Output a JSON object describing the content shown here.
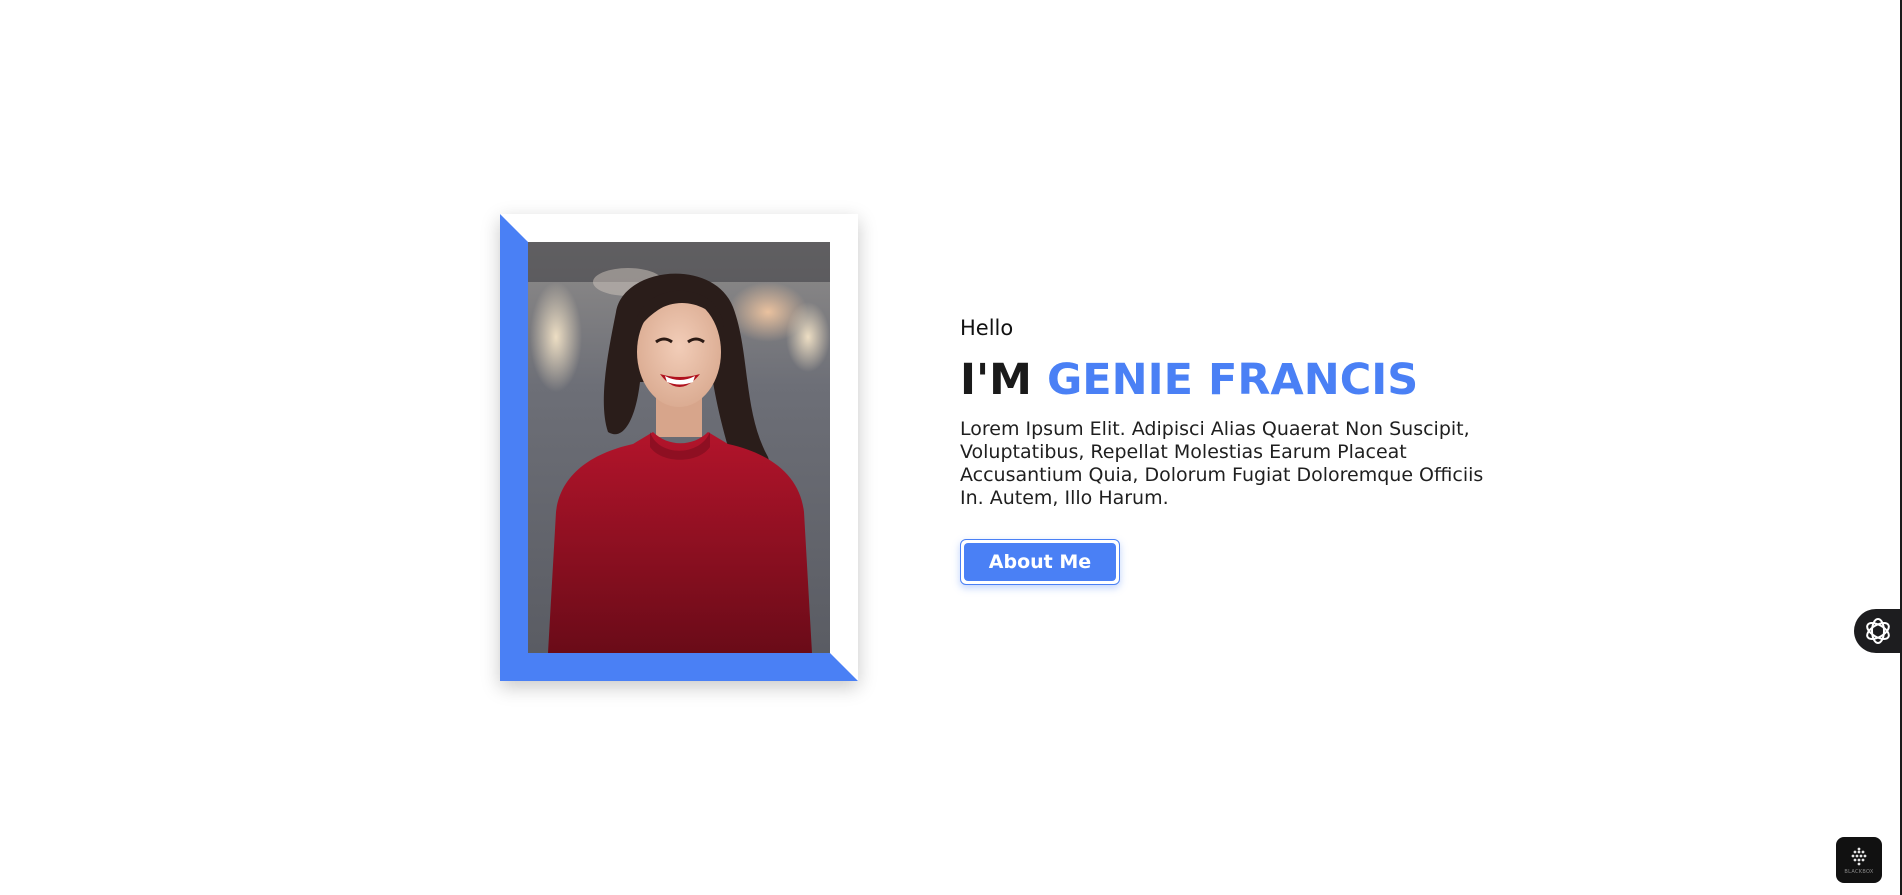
{
  "hero": {
    "greeting": "Hello",
    "headline_prefix": "I'M",
    "headline_name": "GENIE FRANCIS",
    "description": "Lorem Ipsum Elit. Adipisci Alias Quaerat Non Suscipit, Voluptatibus, Repellat Molestias Earum Placeat Accusantium Quia, Dolorum Fugiat Doloremque Officiis In. Autem, Illo Harum.",
    "button_label": "About Me"
  },
  "photo": {
    "icon": "portrait-photo",
    "subject": "smiling woman in red top"
  },
  "widgets": {
    "side_icon": "openai-logo-icon",
    "corner_icon": "blackbox-logo-icon",
    "corner_label": "BLACKBOX"
  },
  "colors": {
    "accent": "#4a80f5",
    "text": "#1a1a1a",
    "background": "#ffffff"
  }
}
